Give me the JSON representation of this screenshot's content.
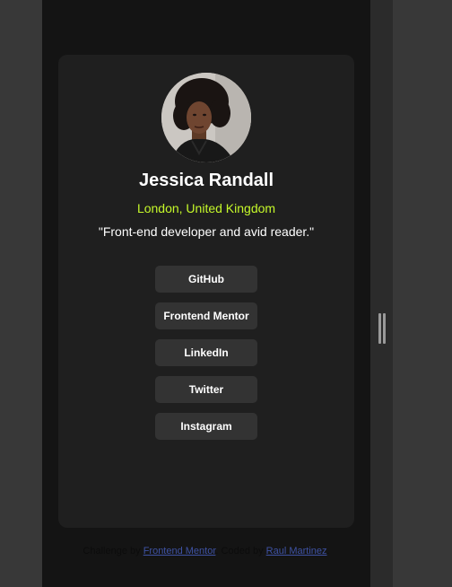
{
  "profile": {
    "name": "Jessica Randall",
    "location": "London, United Kingdom",
    "bio": "\"Front-end developer and avid reader.\"",
    "avatar_icon": "portrait-photo"
  },
  "links": [
    {
      "label": "GitHub"
    },
    {
      "label": "Frontend Mentor"
    },
    {
      "label": "LinkedIn"
    },
    {
      "label": "Twitter"
    },
    {
      "label": "Instagram"
    }
  ],
  "attribution": {
    "prefix": "Challenge by ",
    "challenge_link": "Frontend Mentor",
    "middle": ". Coded by ",
    "author_link": "Raul Martinez",
    "suffix": "."
  },
  "colors": {
    "page_bg": "#141414",
    "card_bg": "#1f1f1f",
    "button_bg": "#333333",
    "accent_green": "#c5f82a",
    "link_blue": "#3e52a3"
  }
}
